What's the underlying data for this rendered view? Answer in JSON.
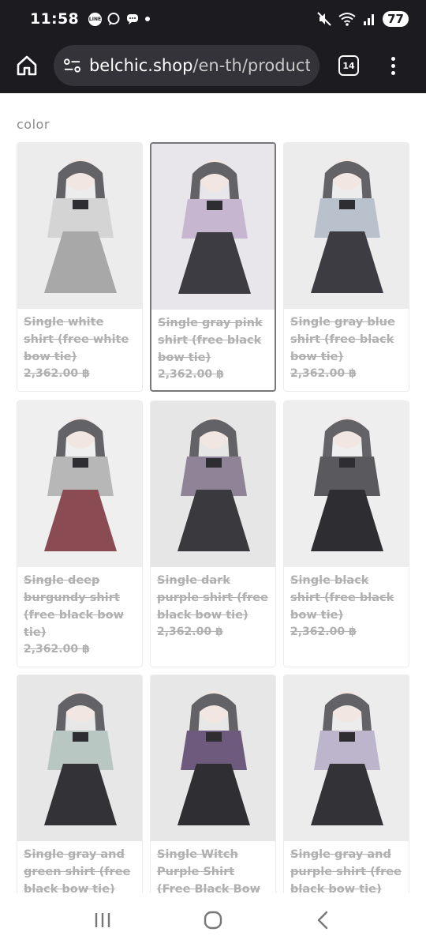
{
  "status_bar": {
    "time": "11:58",
    "line_label": "LINE",
    "battery": "77"
  },
  "browser": {
    "url_host": "belchic.shop",
    "url_path": "/en-th/products",
    "tab_count": "14"
  },
  "page": {
    "section_label": "color",
    "products": [
      {
        "name": "Single white shirt (free white bow tie)",
        "price": "2,362.00 ฿",
        "selected": false,
        "colors": [
          "#ececec",
          "#d4d4d4",
          "#a8a8a8"
        ]
      },
      {
        "name": "Single gray pink shirt (free black bow tie)",
        "price": "2,362.00 ฿",
        "selected": true,
        "colors": [
          "#e8e6ea",
          "#c7b6cf",
          "#3c3c42"
        ]
      },
      {
        "name": "Single gray blue shirt (free black bow tie)",
        "price": "2,362.00 ฿",
        "selected": false,
        "colors": [
          "#ececec",
          "#b9c2cc",
          "#3c3c42"
        ]
      },
      {
        "name": "Single deep burgundy shirt (free black bow tie)",
        "price": "2,362.00 ฿",
        "selected": false,
        "colors": [
          "#efefef",
          "#b7b7b7",
          "#8a4c52"
        ]
      },
      {
        "name": "Single dark purple shirt (free black bow tie)",
        "price": "2,362.00 ฿",
        "selected": false,
        "colors": [
          "#e6e6e6",
          "#8f8497",
          "#3a3a3e"
        ]
      },
      {
        "name": "Single black shirt (free black bow tie)",
        "price": "2,362.00 ฿",
        "selected": false,
        "colors": [
          "#eeeeee",
          "#5a5a5e",
          "#2e2e32"
        ]
      },
      {
        "name": "Single gray and green shirt (free black bow tie)",
        "price": "",
        "selected": false,
        "colors": [
          "#e7e7e7",
          "#b8c7c2",
          "#333337"
        ]
      },
      {
        "name": "Single Witch Purple Shirt (Free Black Bow Tie)",
        "price": "",
        "selected": false,
        "colors": [
          "#e7e7e7",
          "#6e5a7c",
          "#2f2f33"
        ]
      },
      {
        "name": "Single gray and purple shirt (free black bow tie)",
        "price": "",
        "selected": false,
        "colors": [
          "#ececec",
          "#bdb5cb",
          "#333337"
        ]
      }
    ]
  }
}
